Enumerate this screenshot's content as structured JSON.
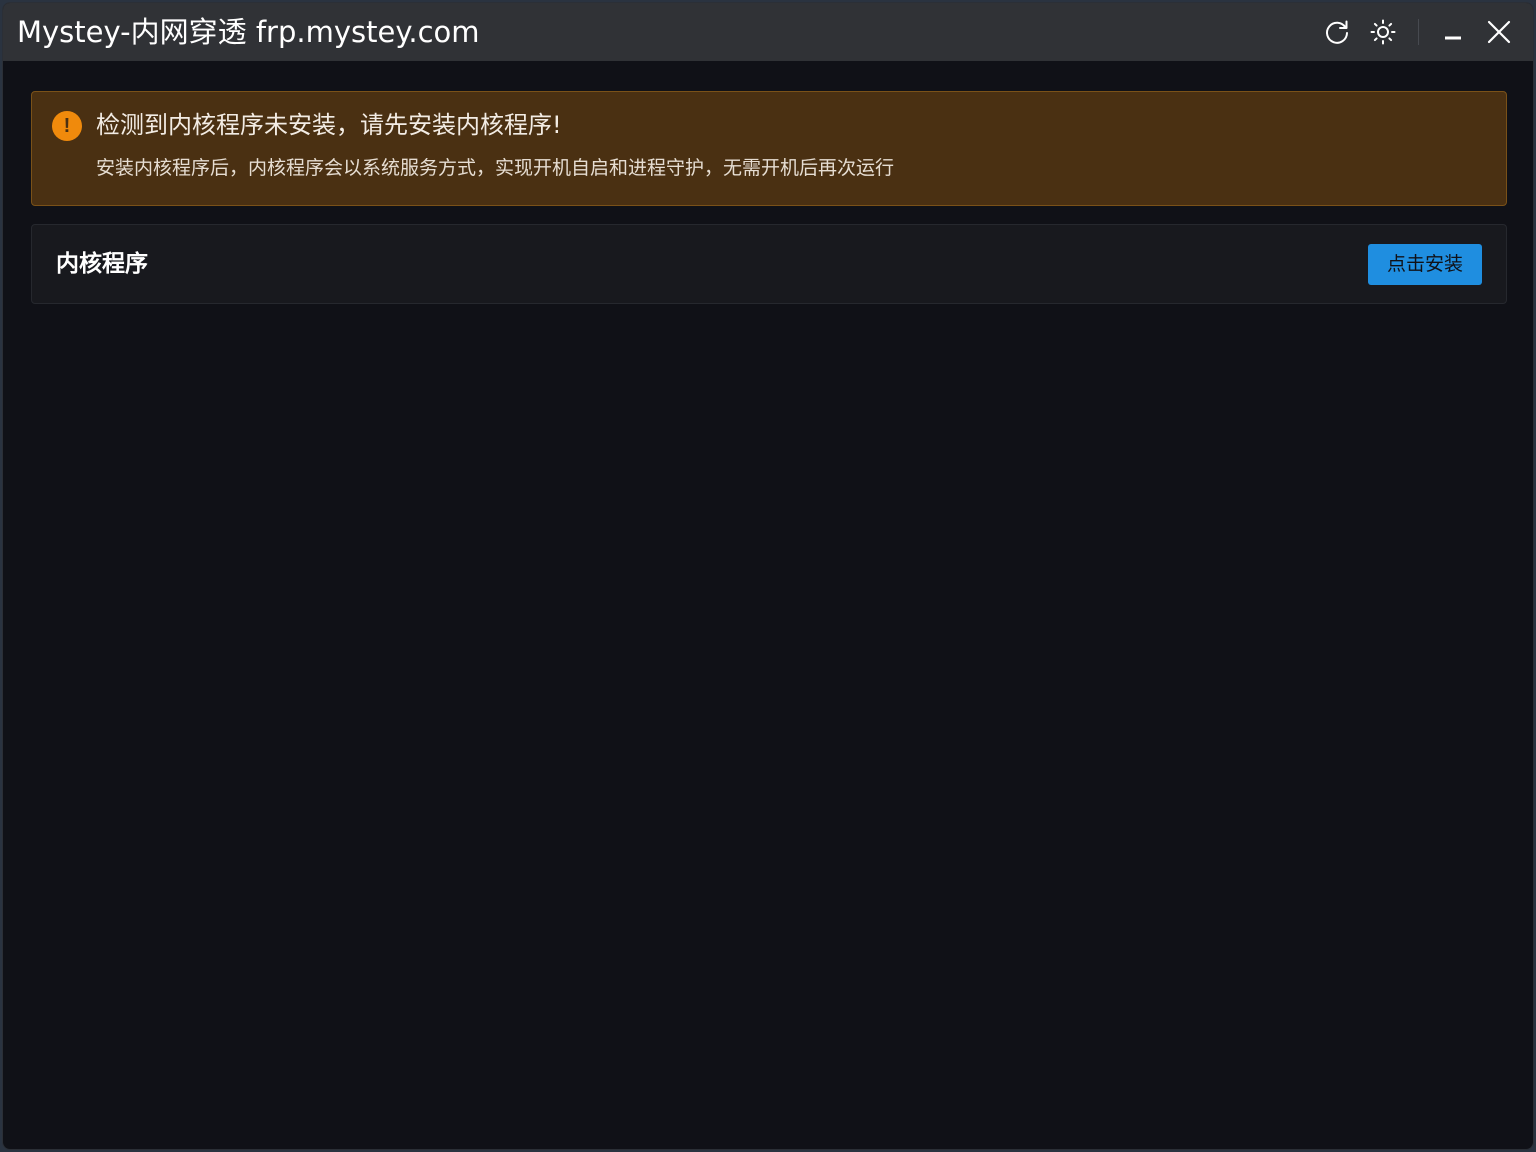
{
  "window": {
    "title": "Mystey-内网穿透 frp.mystey.com",
    "controls": {
      "refresh_icon": "refresh-icon",
      "theme_icon": "sun-icon",
      "minimize_icon": "minimize-icon",
      "close_icon": "close-icon"
    }
  },
  "alert": {
    "type": "warning",
    "icon": "exclamation-icon",
    "icon_glyph": "!",
    "title": "检测到内核程序未安装，请先安装内核程序!",
    "description": "安装内核程序后，内核程序会以系统服务方式，实现开机自启和进程守护，无需开机后再次运行"
  },
  "kernel_card": {
    "title": "内核程序",
    "install_button_label": "点击安装"
  },
  "colors": {
    "background": "#101117",
    "titlebar": "#303236",
    "alert_background": "#4a3012",
    "alert_icon": "#f08a0c",
    "primary_button": "#1f8ee0"
  }
}
